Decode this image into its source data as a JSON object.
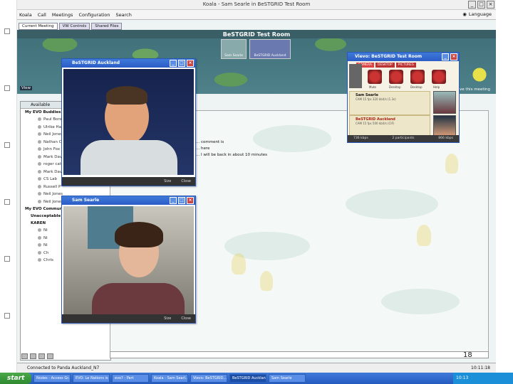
{
  "window": {
    "title": "Koala - Sam Searle in BeSTGRID Test Room"
  },
  "menu": [
    "Koala",
    "Call",
    "Meetings",
    "Configuration",
    "Search"
  ],
  "language_label": "Language",
  "tabs": [
    "Current Meeting",
    "VW Controls",
    "Shared Files"
  ],
  "room": {
    "title": "BeSTGRID Test Room",
    "thumbs": [
      "Sam Searle",
      "BeSTGRID Auckland"
    ],
    "status": "ave this meeting",
    "views_label": "View"
  },
  "contacts": {
    "header": "Available",
    "group1": "My EVO Buddies",
    "buddies": [
      "Paul Bonn",
      "Ulrike Ham",
      "Neil Jones",
      "Nathan C",
      "John Fox",
      "Mark Dav",
      "roger cat",
      "Mark Dav",
      "CS Lab",
      "Russell P",
      "Neil Jones"
    ],
    "buddy_last": "Neil Jones",
    "group2": "My EVO Communities",
    "sub1": "Unacceptable",
    "sub2": "KAREN",
    "sub_items": [
      "Ni",
      "Ni",
      "Ni",
      "Ch",
      "Chris"
    ]
  },
  "chat": {
    "lines": [
      "... comment is",
      "... here",
      "... I will be back in about 10 minutes"
    ]
  },
  "video1": {
    "title": "BeSTGRID Auckland",
    "btn_size": "Size",
    "btn_close": "Close"
  },
  "video2": {
    "title": "Sam Searle",
    "btn_size": "Size",
    "btn_close": "Close"
  },
  "viewer": {
    "title": "Vievo: BeSTGRID Test Room",
    "tabs": [
      "CAMERA",
      "DESKTOP",
      "PICTURES"
    ],
    "controls": [
      "Mute",
      "Desktop",
      "Desktop",
      "Help"
    ],
    "participants": [
      {
        "name": "Sam Searle",
        "line": "CAM  15 fps  320 kbit/s  (1.3s)"
      },
      {
        "name": "BeSTGRID Auckland",
        "line": "CAM  15 fps  500 kbit/s  (CIF)"
      }
    ],
    "status_left": "736 kbps",
    "status_mid": "2 participants",
    "status_right": "866 kbps"
  },
  "bottom": {
    "page_number": "18"
  },
  "statusbar": {
    "text": "Connected to Panda Auckland_N7",
    "time": "10:11:18"
  },
  "taskbar": {
    "start": "start",
    "tasks": [
      "Nodes - Access Gr...",
      "EVO: Le Nations is ...",
      "evo? - Part",
      "Koala - Sam Searl...",
      "Vievo: BeSTGRID...",
      "BeSTGRID Auckland",
      "Sam Searle"
    ],
    "tray": "10:13"
  },
  "colors": {
    "accent": "#2b5cc6",
    "start": "#2f8a2f",
    "pond": "#4e818a"
  }
}
